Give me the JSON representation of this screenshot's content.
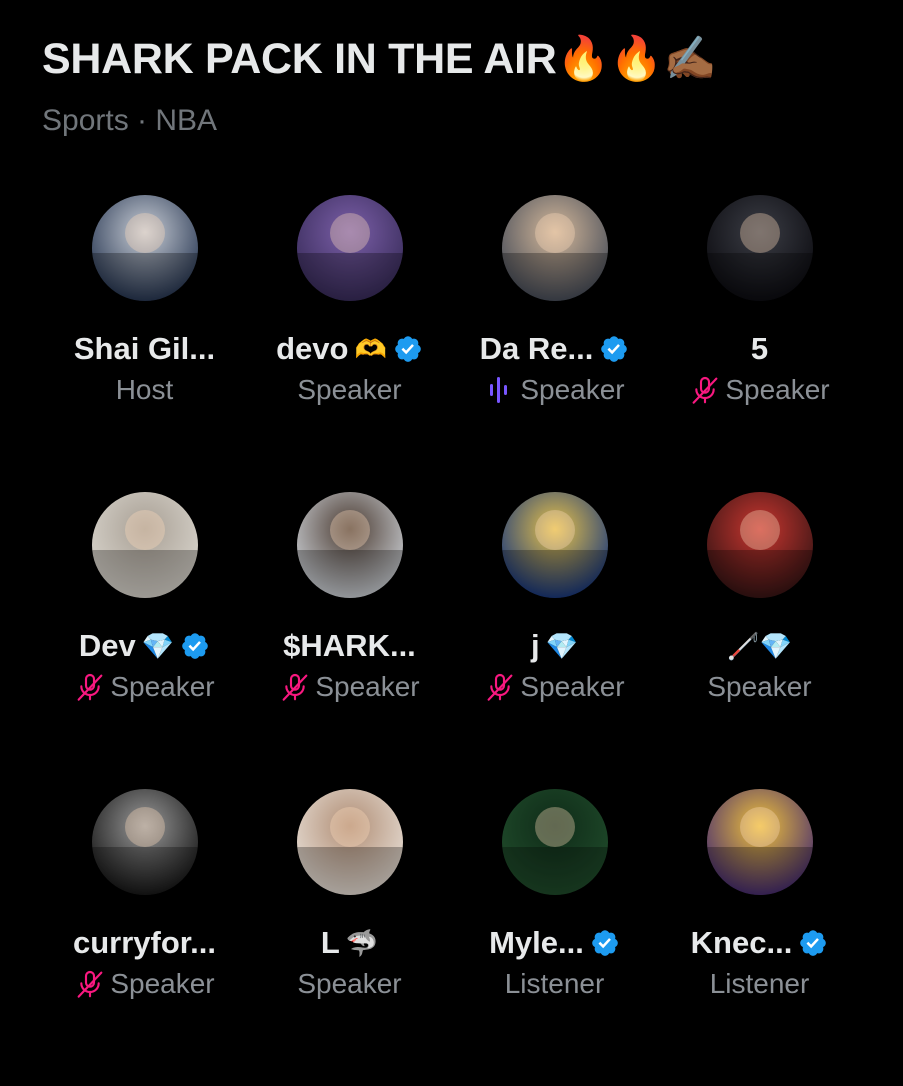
{
  "space": {
    "title": "SHARK PACK IN THE AIR🔥🔥✍🏾",
    "subtitle": "Sports · NBA"
  },
  "colors": {
    "background": "#000000",
    "text": "#e7e9ea",
    "muted": "#71767b",
    "verified": "#1d9bf0",
    "muted_mic": "#f91880",
    "speaking_wave": "#7856ff"
  },
  "participants": [
    {
      "name": "Shai Gil...",
      "emoji": "",
      "verified": false,
      "role": "Host",
      "status_icon": "none",
      "avatar_colors": [
        "#2b3a55",
        "#c9ced6"
      ]
    },
    {
      "name": "devo",
      "emoji": "🫶",
      "verified": true,
      "role": "Speaker",
      "status_icon": "none",
      "avatar_colors": [
        "#3a2d5c",
        "#7b5fa8"
      ]
    },
    {
      "name": "Da Re...",
      "emoji": "",
      "verified": true,
      "role": "Speaker",
      "status_icon": "speaking-wave-icon",
      "avatar_colors": [
        "#4a4f5a",
        "#d4b89a"
      ]
    },
    {
      "name": "5",
      "emoji": "",
      "verified": false,
      "role": "Speaker",
      "status_icon": "muted-mic-icon",
      "avatar_colors": [
        "#0d0d12",
        "#3b3d45"
      ]
    },
    {
      "name": "Dev",
      "emoji": "💎",
      "verified": true,
      "role": "Speaker",
      "status_icon": "muted-mic-icon",
      "avatar_colors": [
        "#d8d4cc",
        "#a89f94"
      ]
    },
    {
      "name": "$HARK...",
      "emoji": "",
      "verified": false,
      "role": "Speaker",
      "status_icon": "muted-mic-icon",
      "avatar_colors": [
        "#c9cdd2",
        "#4a3a30"
      ]
    },
    {
      "name": "j",
      "emoji": "💎",
      "verified": false,
      "role": "Speaker",
      "status_icon": "muted-mic-icon",
      "avatar_colors": [
        "#1d3a7a",
        "#e8c34a"
      ]
    },
    {
      "name": "",
      "emoji": "🦯💎",
      "verified": false,
      "role": "Speaker",
      "status_icon": "none",
      "avatar_colors": [
        "#3a1515",
        "#c9362f"
      ]
    },
    {
      "name": "curryfor...",
      "emoji": "",
      "verified": false,
      "role": "Speaker",
      "status_icon": "muted-mic-icon",
      "avatar_colors": [
        "#1a1a1a",
        "#9a9a9a"
      ]
    },
    {
      "name": "L",
      "emoji": "🦈",
      "verified": false,
      "role": "Speaker",
      "status_icon": "none",
      "avatar_colors": [
        "#e6ddd4",
        "#b08d74"
      ]
    },
    {
      "name": "Myle...",
      "emoji": "",
      "verified": true,
      "role": "Listener",
      "status_icon": "none",
      "avatar_colors": [
        "#1f4a2a",
        "#0f2b18"
      ]
    },
    {
      "name": "Knec...",
      "emoji": "",
      "verified": true,
      "role": "Listener",
      "status_icon": "none",
      "avatar_colors": [
        "#4a2f6e",
        "#f0c23b"
      ]
    }
  ]
}
